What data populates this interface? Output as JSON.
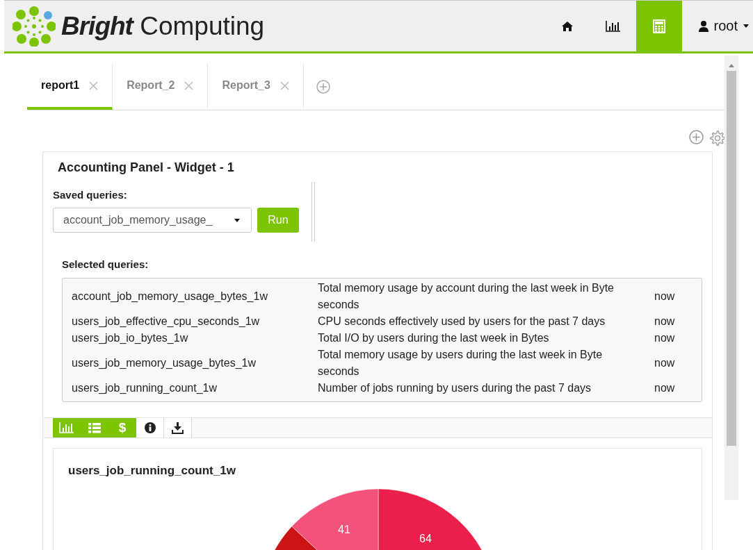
{
  "header": {
    "brand_bold": "Bright",
    "brand_light": "Computing",
    "nav": [
      {
        "kind": "home",
        "selected": false
      },
      {
        "kind": "chart",
        "selected": false
      },
      {
        "kind": "calculator",
        "selected": true
      },
      {
        "kind": "user",
        "label": "root",
        "selected": false
      }
    ]
  },
  "tabs": [
    {
      "label": "report1",
      "selected": true
    },
    {
      "label": "Report_2",
      "selected": false
    },
    {
      "label": "Report_3",
      "selected": false
    }
  ],
  "panel": {
    "title": "Accounting Panel - Widget - 1",
    "saved_label": "Saved queries:",
    "saved_value": "account_job_memory_usage_",
    "run_label": "Run",
    "selected_label": "Selected queries:",
    "queries": [
      {
        "name": "account_job_memory_usage_bytes_1w",
        "description": "Total memory usage by account during the last week in Byte seconds",
        "time": "now"
      },
      {
        "name": "users_job_effective_cpu_seconds_1w",
        "description": "CPU seconds effectively used by users for the past 7 days",
        "time": "now"
      },
      {
        "name": "users_job_io_bytes_1w",
        "description": "Total I/O by users during the last week in Bytes",
        "time": "now"
      },
      {
        "name": "users_job_memory_usage_bytes_1w",
        "description": "Total memory usage by users during the last week in Byte seconds",
        "time": "now"
      },
      {
        "name": "users_job_running_count_1w",
        "description": "Number of jobs running by users during the past 7 days",
        "time": "now"
      }
    ],
    "toolbar": [
      {
        "kind": "chart",
        "highlighted": true
      },
      {
        "kind": "list",
        "highlighted": true
      },
      {
        "kind": "text",
        "label": "$",
        "highlighted": true
      },
      {
        "kind": "info",
        "highlighted": false
      },
      {
        "kind": "download",
        "highlighted": false
      }
    ],
    "chart_title": "users_job_running_count_1w",
    "slices": [
      {
        "label": "64",
        "color": "#eb1f4b"
      },
      {
        "label": "41",
        "color": "#f3537b"
      },
      {
        "color": "#cc1414"
      }
    ]
  }
}
